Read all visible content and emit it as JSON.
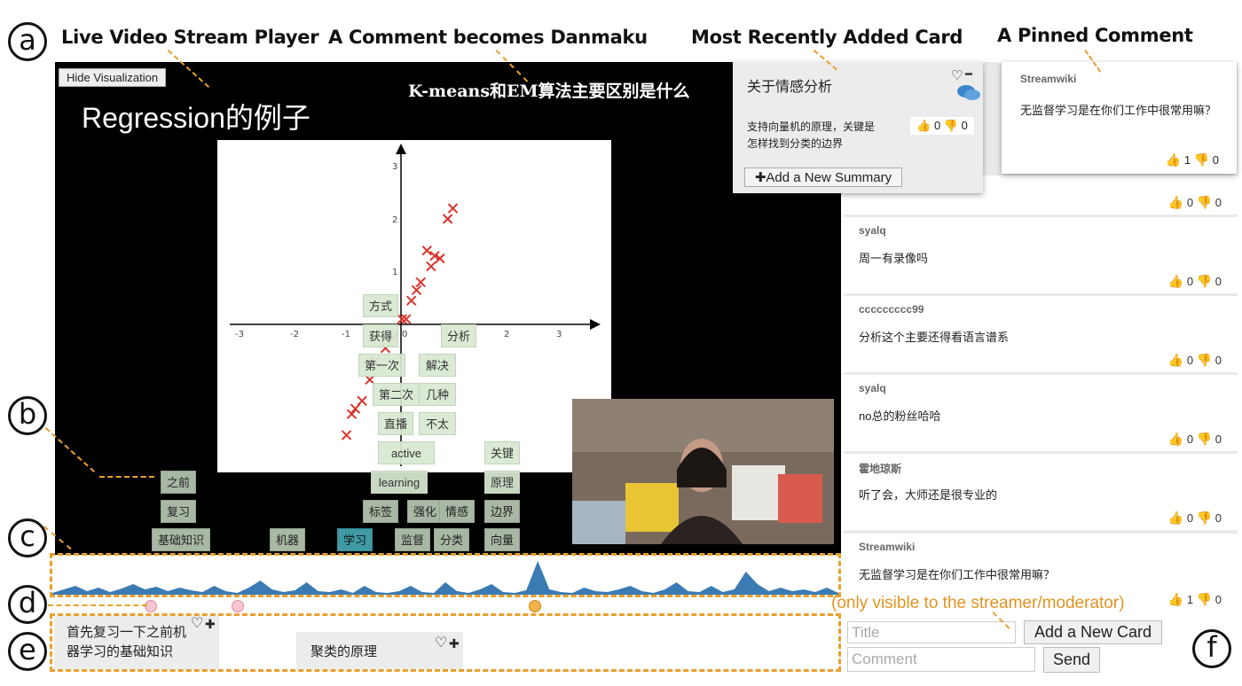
{
  "annotations": {
    "a": "a",
    "b": "b",
    "c": "c",
    "d": "d",
    "e": "e",
    "f": "f",
    "player": "Live Video Stream Player",
    "danmaku": "A Comment becomes Danmaku",
    "recent_card": "Most Recently Added Card",
    "pinned": "A Pinned Comment",
    "moderator_note": "(only visible to the streamer/moderator)"
  },
  "video": {
    "hide_button": "Hide Visualization",
    "slide_title": "Regression的例子",
    "danmaku_text": "K-means和EM算法主要区别是什么"
  },
  "plot": {
    "x_ticks": [
      "-3",
      "-2",
      "-1",
      "0",
      "1",
      "2",
      "3"
    ],
    "y_ticks": [
      "3",
      "2",
      "1"
    ]
  },
  "wordcloud": {
    "tags": [
      "方式",
      "获得",
      "分析",
      "第一次",
      "解决",
      "第二次",
      "几种",
      "直播",
      "不太",
      "active",
      "关键",
      "learning",
      "原理",
      "之前",
      "复习",
      "标签",
      "强化",
      "情感",
      "边界",
      "基础知识",
      "机器",
      "学习",
      "监督",
      "分类",
      "向量"
    ]
  },
  "top_card": {
    "title": "关于情感分析",
    "body_line1": "支持向量机的原理，关键是",
    "body_line2": "怎样找到分类的边界",
    "up": "0",
    "down": "0",
    "add_summary": "✚Add a New Summary"
  },
  "pinned_comment": {
    "user": "Streamwiki",
    "text": "无监督学习是在你们工作中很常用嘛？",
    "up": "1",
    "down": "0"
  },
  "comments": [
    {
      "user": "",
      "text": "",
      "up": "0",
      "down": "0"
    },
    {
      "user": "syalq",
      "text": "周一有录像吗",
      "up": "0",
      "down": "0"
    },
    {
      "user": "ccccccccc99",
      "text": "分析这个主要还得看语言谱系",
      "up": "0",
      "down": "0"
    },
    {
      "user": "syalq",
      "text": "no总的粉丝哈哈",
      "up": "0",
      "down": "0"
    },
    {
      "user": "霍地琼斯",
      "text": "听了会，大师还是很专业的",
      "up": "0",
      "down": "0"
    },
    {
      "user": "Streamwiki",
      "text": "无监督学习是在你们工作中很常用嘛？",
      "up": "1",
      "down": "0"
    }
  ],
  "summary_cards": [
    {
      "text_line1": "首先复习一下之前机",
      "text_line2": "器学习的基础知识",
      "heart": "♡",
      "plus": "✚"
    },
    {
      "text_line1": "聚类的原理",
      "text_line2": "",
      "heart": "♡",
      "plus": "✚"
    }
  ],
  "inputs": {
    "title_placeholder": "Title",
    "add_card": "Add a New Card",
    "comment_placeholder": "Comment",
    "send": "Send"
  },
  "icons": {
    "thumb_up": "👍",
    "thumb_down": "👎",
    "heart": "♡",
    "minus": "━"
  },
  "colors": {
    "accent": "#e8a02c",
    "timeline": "#3b7bb4",
    "pin_pink": "#f8c6d0",
    "pin_orange": "#f0b24a",
    "tag_teal": "#3f9aa4"
  }
}
